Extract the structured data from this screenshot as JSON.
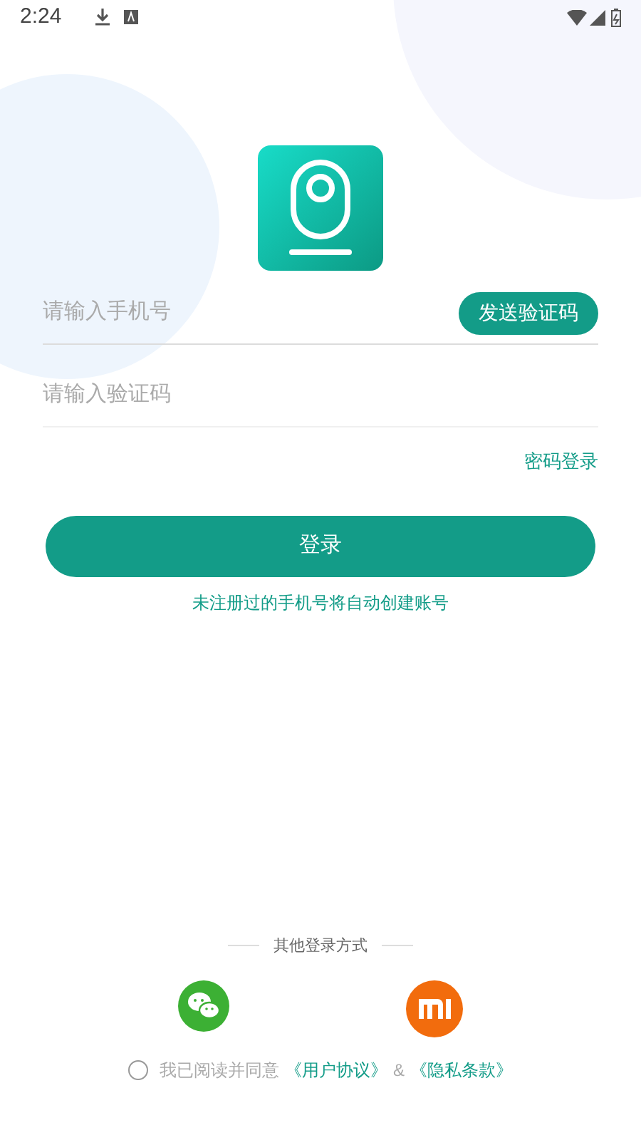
{
  "status_bar": {
    "time": "2:24"
  },
  "phone_field": {
    "placeholder": "请输入手机号"
  },
  "send_code_button": "发送验证码",
  "code_field": {
    "placeholder": "请输入验证码"
  },
  "password_login_link": "密码登录",
  "login_button": "登录",
  "auto_register_note": "未注册过的手机号将自动创建账号",
  "other_login": {
    "title": "其他登录方式",
    "options": [
      {
        "kind": "wechat"
      },
      {
        "kind": "xiaomi"
      }
    ]
  },
  "agreement": {
    "checked": false,
    "text": "我已阅读并同意",
    "user_agreement": "《用户协议》",
    "separator": "&",
    "privacy_policy": "《隐私条款》"
  }
}
